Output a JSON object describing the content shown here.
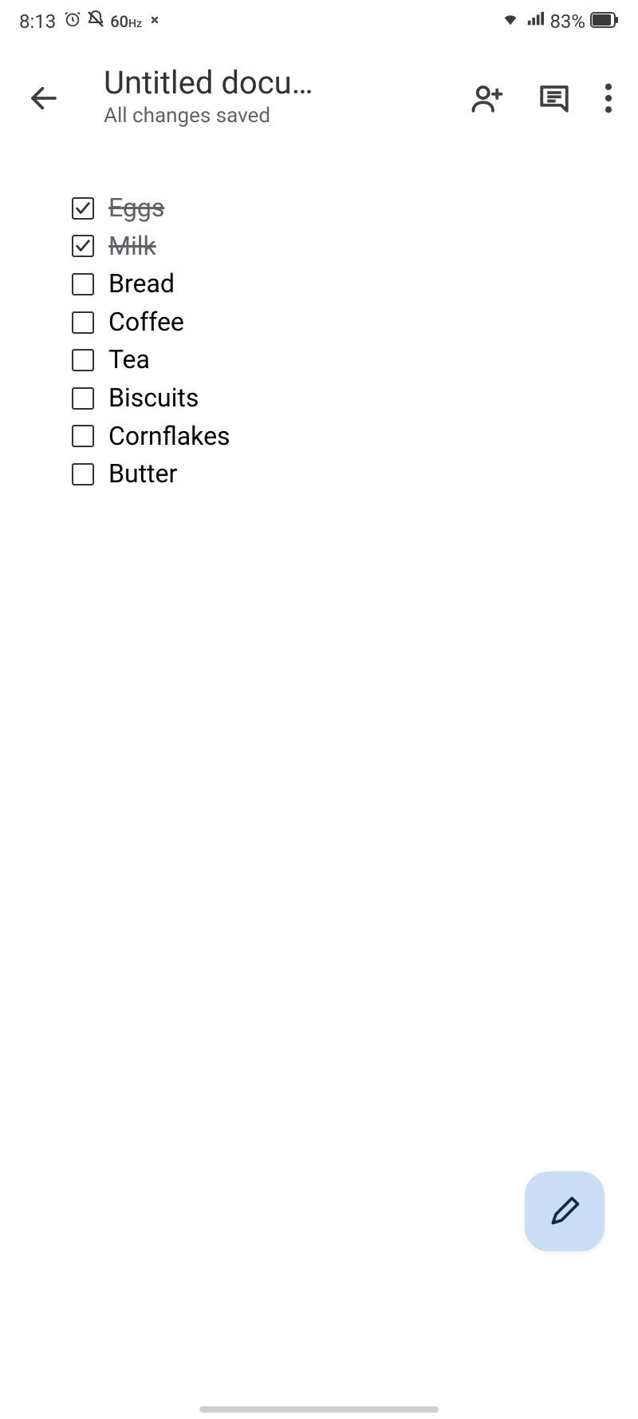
{
  "status_bar": {
    "time": "8:13",
    "refresh_rate": "60",
    "refresh_unit": "Hz",
    "battery_percent": "83%"
  },
  "header": {
    "title": "Untitled docu…",
    "save_status": "All changes saved"
  },
  "checklist": [
    {
      "label": "Eggs",
      "checked": true
    },
    {
      "label": "Milk",
      "checked": true
    },
    {
      "label": "Bread",
      "checked": false
    },
    {
      "label": "Coffee",
      "checked": false
    },
    {
      "label": "Tea",
      "checked": false
    },
    {
      "label": "Biscuits",
      "checked": false
    },
    {
      "label": "Cornflakes",
      "checked": false
    },
    {
      "label": "Butter",
      "checked": false
    }
  ]
}
